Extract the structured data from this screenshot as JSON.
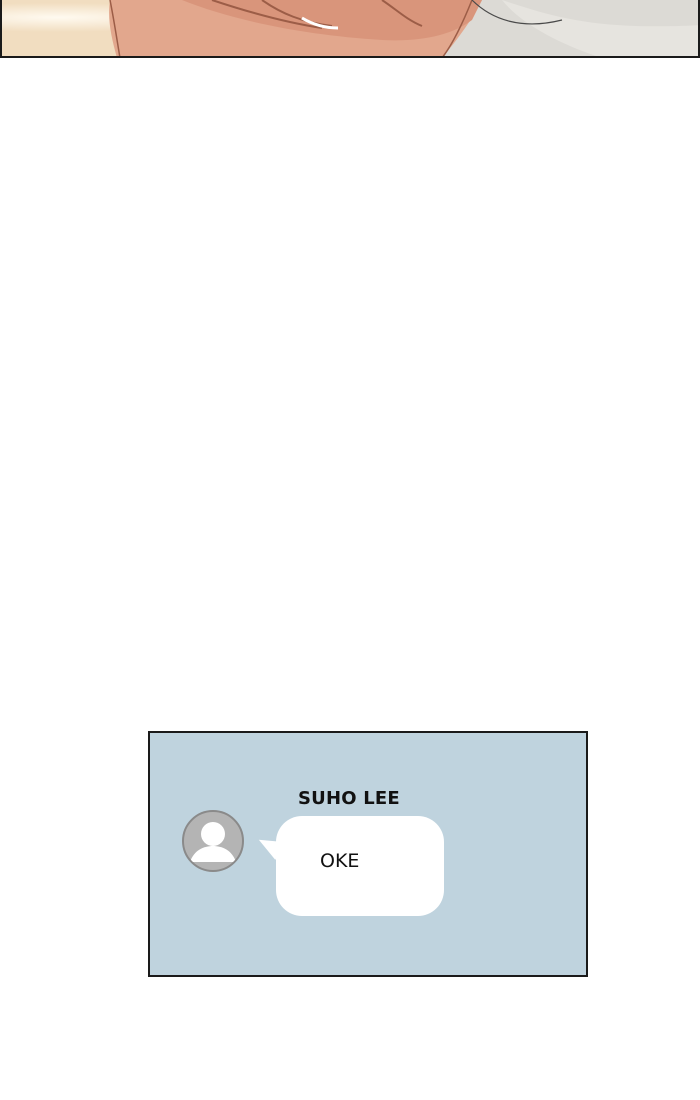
{
  "top_panel": {
    "description_icon": "hands-illustration"
  },
  "chat": {
    "sender_name": "SUHO LEE",
    "message": "OKE",
    "avatar_icon": "default-user-avatar-icon"
  }
}
